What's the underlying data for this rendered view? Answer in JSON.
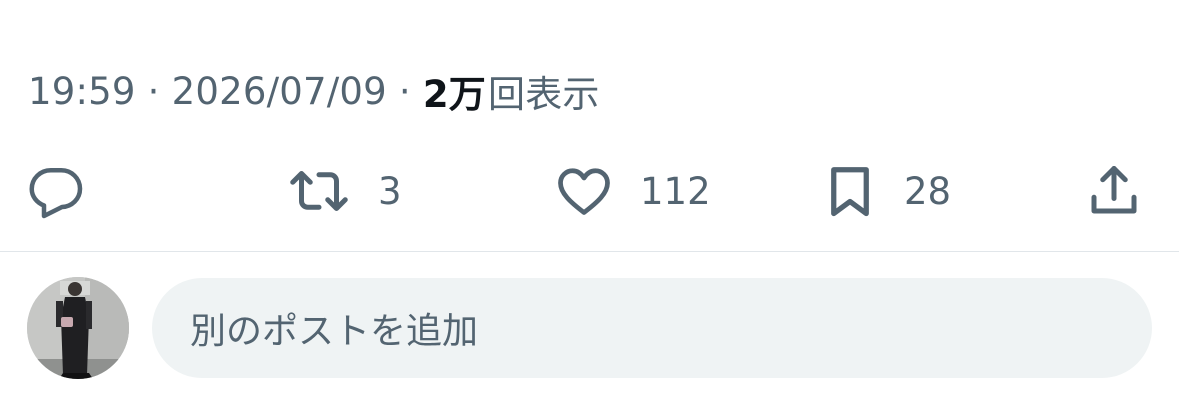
{
  "meta": {
    "time": "19:59",
    "date": "2026/07/09",
    "separator": "·",
    "views_count": "2万",
    "views_label": "回表示"
  },
  "actions": {
    "reply": {
      "icon": "reply-icon",
      "count": ""
    },
    "repost": {
      "icon": "repost-icon",
      "count": "3"
    },
    "like": {
      "icon": "heart-icon",
      "count": "112"
    },
    "bookmark": {
      "icon": "bookmark-icon",
      "count": "28"
    },
    "share": {
      "icon": "share-icon"
    }
  },
  "composer": {
    "placeholder": "別のポストを追加"
  },
  "colors": {
    "text_secondary": "#536471",
    "text_primary": "#0f1419",
    "divider": "#e1e6ea",
    "input_background": "#eff3f4"
  }
}
